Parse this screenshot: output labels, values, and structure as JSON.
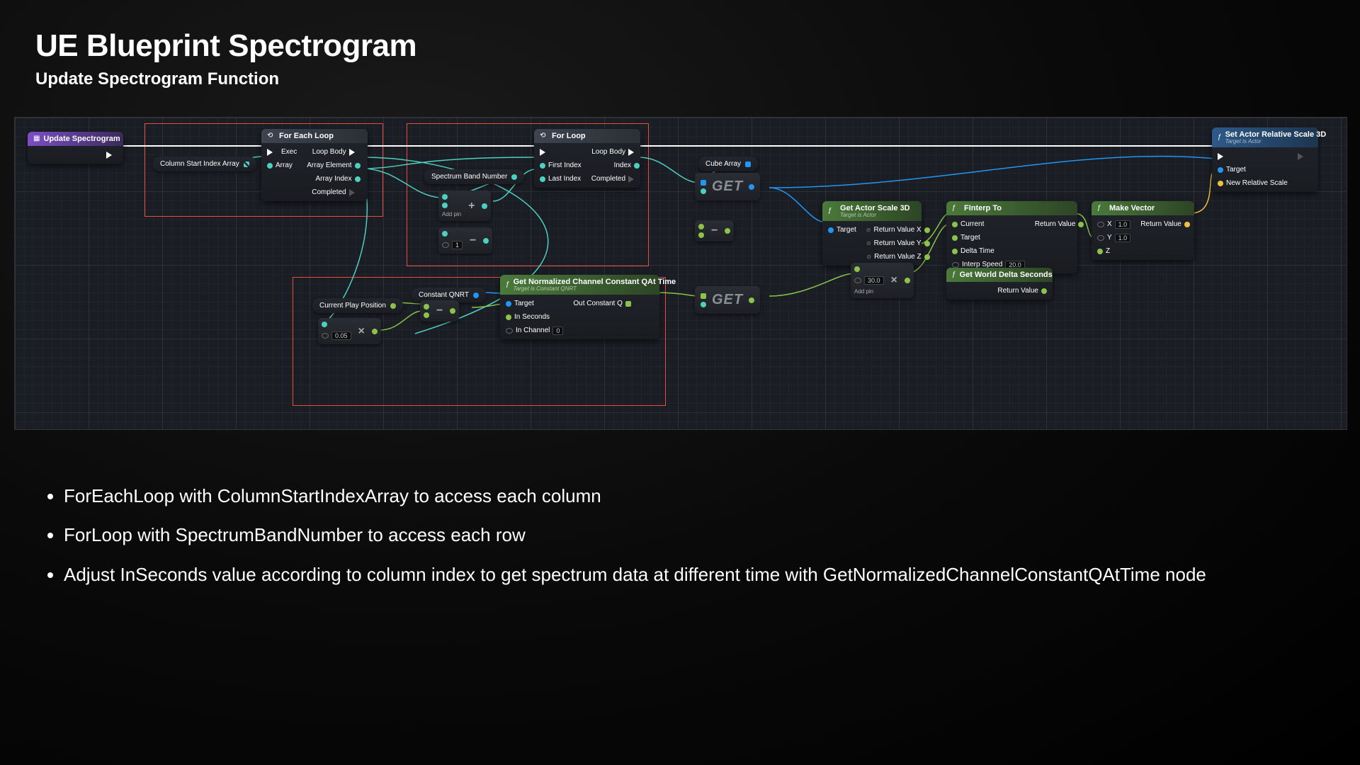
{
  "header": {
    "title": "UE Blueprint Spectrogram",
    "subtitle": "Update Spectrogram Function"
  },
  "nodes": {
    "entry": {
      "title": "Update Spectrogram"
    },
    "foreach": {
      "title": "For Each Loop",
      "pins": {
        "exec": "Exec",
        "array": "Array",
        "loopbody": "Loop Body",
        "elem": "Array Element",
        "idx": "Array Index",
        "done": "Completed"
      }
    },
    "forloop": {
      "title": "For Loop",
      "pins": {
        "first": "First Index",
        "last": "Last Index",
        "loopbody": "Loop Body",
        "idx": "Index",
        "done": "Completed"
      }
    },
    "colstart": {
      "label": "Column Start Index Array"
    },
    "spectrumband": {
      "label": "Spectrum Band Number"
    },
    "cubearr": {
      "label": "Cube Array"
    },
    "constq": {
      "label": "Constant QNRT"
    },
    "playpos": {
      "label": "Current Play Position"
    },
    "getnorm": {
      "title": "Get Normalized Channel Constant QAt Time",
      "sub": "Target is Constant QNRT",
      "pins": {
        "target": "Target",
        "insec": "In Seconds",
        "inch": "In Channel",
        "inch_val": "0",
        "out": "Out Constant Q"
      }
    },
    "getscale": {
      "title": "Get Actor Scale 3D",
      "sub": "Target is Actor",
      "pins": {
        "target": "Target",
        "rx": "Return Value X",
        "ry": "Return Value Y",
        "rz": "Return Value Z"
      }
    },
    "finterp": {
      "title": "FInterp To",
      "pins": {
        "cur": "Current",
        "tgt": "Target",
        "dt": "Delta Time",
        "spd": "Interp Speed",
        "spd_val": "20.0",
        "ret": "Return Value"
      }
    },
    "worlddelta": {
      "title": "Get World Delta Seconds",
      "pins": {
        "ret": "Return Value"
      }
    },
    "makevec": {
      "title": "Make Vector",
      "pins": {
        "x": "X",
        "xval": "1.0",
        "y": "Y",
        "yval": "1.0",
        "z": "Z",
        "ret": "Return Value"
      }
    },
    "setscale": {
      "title": "Set Actor Relative Scale 3D",
      "sub": "Target is Actor",
      "pins": {
        "target": "Target",
        "newscale": "New Relative Scale"
      }
    },
    "addpin": "Add pin",
    "math": {
      "plus": "+",
      "minus": "−",
      "mult": "×",
      "mult_val1": "0.05",
      "mult_val2": "30.0",
      "minus_val": "1"
    }
  },
  "get_label": "GET",
  "bullets": [
    "ForEachLoop with ColumnStartIndexArray to access each column",
    "ForLoop with SpectrumBandNumber to access each row",
    "Adjust InSeconds value according to column index to get spectrum data at different time with GetNormalizedChannelConstantQAtTime node"
  ]
}
